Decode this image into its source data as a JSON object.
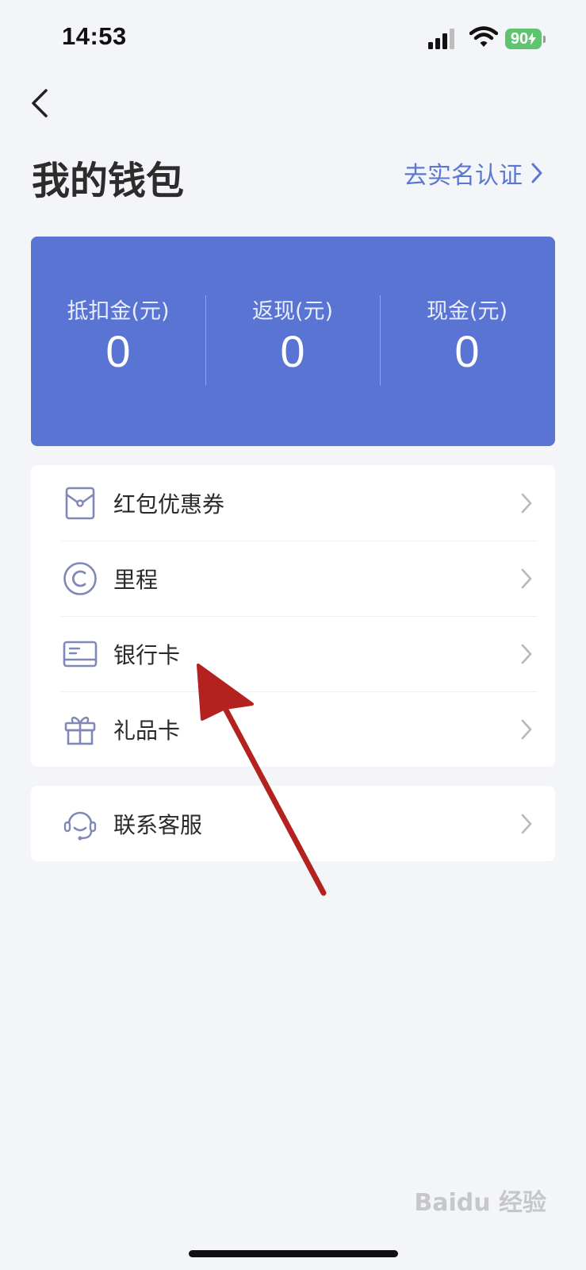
{
  "status_bar": {
    "time": "14:53",
    "battery": "90"
  },
  "header": {
    "title": "我的钱包",
    "verify_link": "去实名认证"
  },
  "balances": [
    {
      "label": "抵扣金(元)",
      "value": "0"
    },
    {
      "label": "返现(元)",
      "value": "0"
    },
    {
      "label": "现金(元)",
      "value": "0"
    }
  ],
  "menu": [
    {
      "label": "红包优惠券",
      "icon": "red-packet-icon"
    },
    {
      "label": "里程",
      "icon": "mileage-icon"
    },
    {
      "label": "银行卡",
      "icon": "bank-card-icon"
    },
    {
      "label": "礼品卡",
      "icon": "gift-card-icon"
    }
  ],
  "support": {
    "label": "联系客服",
    "icon": "headset-icon"
  },
  "watermark": "Baidu 经验",
  "colors": {
    "accent": "#5a74d3",
    "link": "#5a78cf",
    "arrow": "#b3221f",
    "icon": "#8088b8"
  }
}
